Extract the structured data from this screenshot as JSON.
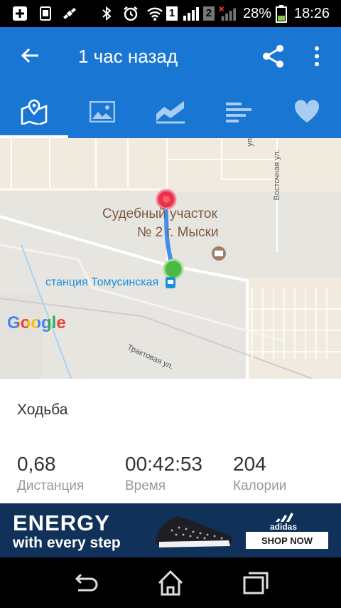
{
  "status_bar": {
    "battery_percent": "28%",
    "time": "18:26",
    "sim1": "1",
    "sim2": "2"
  },
  "app_bar": {
    "title": "1 час назад",
    "back_icon": "arrow-left-icon",
    "share_icon": "share-icon",
    "more_icon": "more-vert-icon"
  },
  "tabs": [
    {
      "icon": "map-icon",
      "selected": true
    },
    {
      "icon": "image-icon",
      "selected": false
    },
    {
      "icon": "chart-icon",
      "selected": false
    },
    {
      "icon": "bars-icon",
      "selected": false
    },
    {
      "icon": "heart-icon",
      "selected": false
    }
  ],
  "map": {
    "poi_line1": "Судебный участок",
    "poi_line2": "№ 2 г. Мыски",
    "station": "станция Томусинская",
    "street_vostochnaya": "Восточная ул.",
    "street_traktovaya": "Трактовая ул.",
    "street_partial": "ул",
    "google_logo": "Google"
  },
  "activity": {
    "type": "Ходьба",
    "stats": [
      {
        "value": "0,68",
        "label": "Дистанция"
      },
      {
        "value": "00:42:53",
        "label": "Время"
      },
      {
        "value": "204",
        "label": "Калории"
      }
    ]
  },
  "ad": {
    "headline": "ENERGY",
    "subline": "with every step",
    "cta": "SHOP NOW",
    "brand": "adidas"
  },
  "colors": {
    "primary": "#1976d2",
    "route": "#3f8ef0",
    "start_marker": "#4cb944",
    "end_marker": "#e8334a"
  }
}
